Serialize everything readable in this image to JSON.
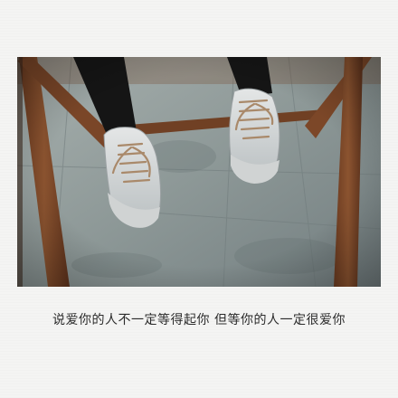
{
  "card": {
    "caption": "说爱你的人不一定等得起你 但等你的人一定很爱你",
    "background_color": "#f4f4f3",
    "photo_subject": "legs in black tights and striped sneakers with brown laces dangling from a wooden stool over a stone pavement"
  }
}
